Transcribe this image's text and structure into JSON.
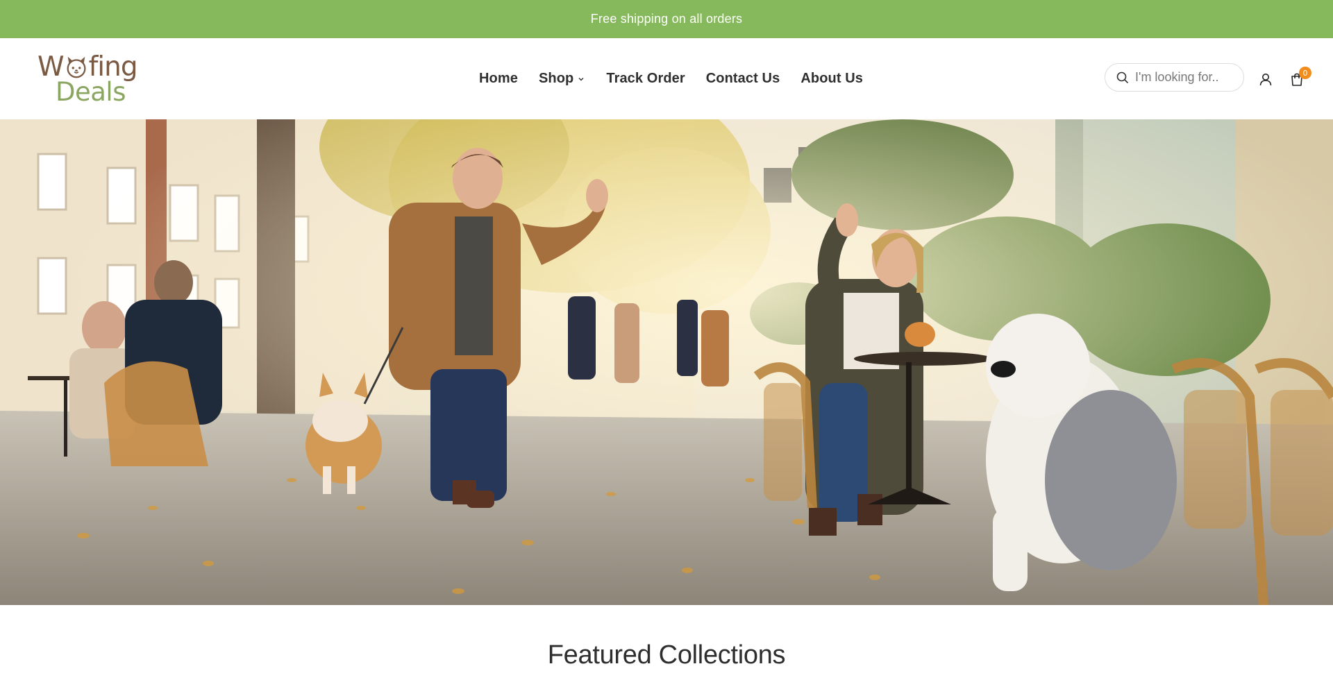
{
  "announcement": {
    "text": "Free shipping on all orders",
    "bg_color": "#86b95b"
  },
  "logo": {
    "line1_start": "W",
    "line1_end": "fing",
    "line2": "Deals",
    "brown": "#7a5a43",
    "green": "#8aa660"
  },
  "nav": {
    "items": [
      {
        "label": "Home"
      },
      {
        "label": "Shop",
        "icon": "chevron-down-icon"
      },
      {
        "label": "Track Order"
      },
      {
        "label": "Contact Us"
      },
      {
        "label": "About Us"
      }
    ]
  },
  "header_tools": {
    "search_placeholder": "I'm looking for..",
    "search_icon": "search-icon",
    "account_icon": "user-icon",
    "cart_icon": "bag-icon",
    "cart_count": "0",
    "badge_color": "#f28c1c"
  },
  "hero": {
    "image_icon": "hero-photo-street-cafe-dogs"
  },
  "featured": {
    "title": "Featured Collections"
  }
}
